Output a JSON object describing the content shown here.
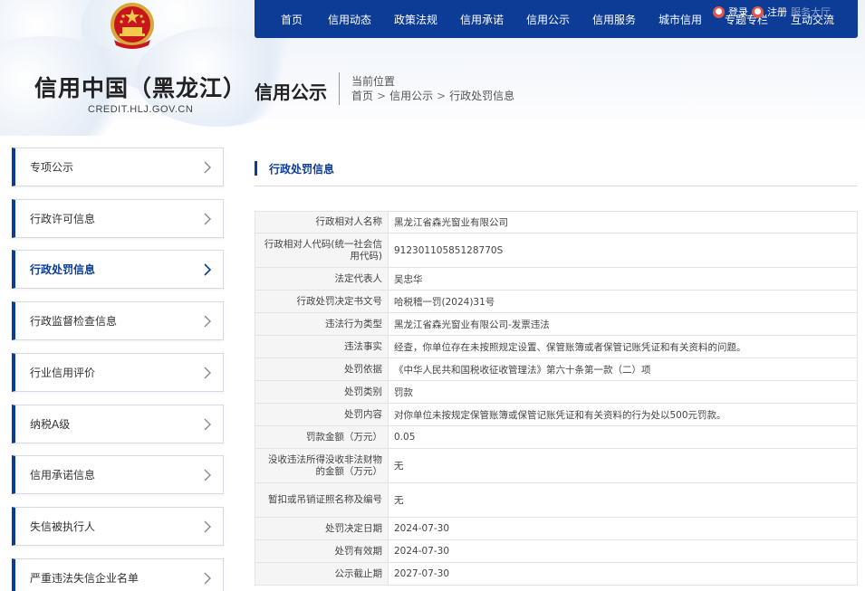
{
  "header": {
    "site_title": "信用中国（黑龙江）",
    "site_domain": "CREDIT.HLJ.GOV.CN",
    "section_title": "信用公示",
    "crumb_label": "当前位置",
    "breadcrumb": [
      "首页",
      "信用公示",
      "行政处罚信息"
    ],
    "breadcrumb_sep": ">"
  },
  "user_links": {
    "login": "登录",
    "register": "注册",
    "extra": "服务大厅"
  },
  "nav": [
    "首页",
    "信用动态",
    "政策法规",
    "信用承诺",
    "信用公示",
    "信用服务",
    "城市信用",
    "专题专栏",
    "互动交流"
  ],
  "sidebar": {
    "items": [
      {
        "label": "专项公示",
        "active": false
      },
      {
        "label": "行政许可信息",
        "active": false
      },
      {
        "label": "行政处罚信息",
        "active": true
      },
      {
        "label": "行政监督检查信息",
        "active": false
      },
      {
        "label": "行业信用评价",
        "active": false
      },
      {
        "label": "纳税A级",
        "active": false
      },
      {
        "label": "信用承诺信息",
        "active": false
      },
      {
        "label": "失信被执行人",
        "active": false
      },
      {
        "label": "严重违法失信企业名单",
        "active": false
      }
    ]
  },
  "main": {
    "title": "行政处罚信息",
    "rows": [
      {
        "k": "行政相对人名称",
        "v": "黑龙江省森光窗业有限公司"
      },
      {
        "k": "行政相对人代码(统一社会信用代码)",
        "v": "91230110585128770S"
      },
      {
        "k": "法定代表人",
        "v": "吴忠华"
      },
      {
        "k": "行政处罚决定书文号",
        "v": "哈税稽一罚(2024)31号"
      },
      {
        "k": "违法行为类型",
        "v": "黑龙江省森光窗业有限公司-发票违法"
      },
      {
        "k": "违法事实",
        "v": "经查，你单位存在未按照规定设置、保管账簿或者保管记账凭证和有关资料的问题。"
      },
      {
        "k": "处罚依据",
        "v": "《中华人民共和国税收征收管理法》第六十条第一款（二）项"
      },
      {
        "k": "处罚类别",
        "v": "罚款"
      },
      {
        "k": "处罚内容",
        "v": "对你单位未按规定保管账簿或保管记账凭证和有关资料的行为处以500元罚款。"
      },
      {
        "k": "罚款金额（万元）",
        "v": "0.05"
      },
      {
        "k": "没收违法所得没收非法财物的金额（万元）",
        "v": "无"
      },
      {
        "k": "暂扣或吊销证照名称及编号",
        "v": "无"
      },
      {
        "k": "处罚决定日期",
        "v": "2024-07-30"
      },
      {
        "k": "处罚有效期",
        "v": "2024-07-30"
      },
      {
        "k": "公示截止期",
        "v": "2027-07-30"
      }
    ]
  },
  "colors": {
    "brand": "#0c3c96",
    "label_bg": "#f5f5f5"
  }
}
